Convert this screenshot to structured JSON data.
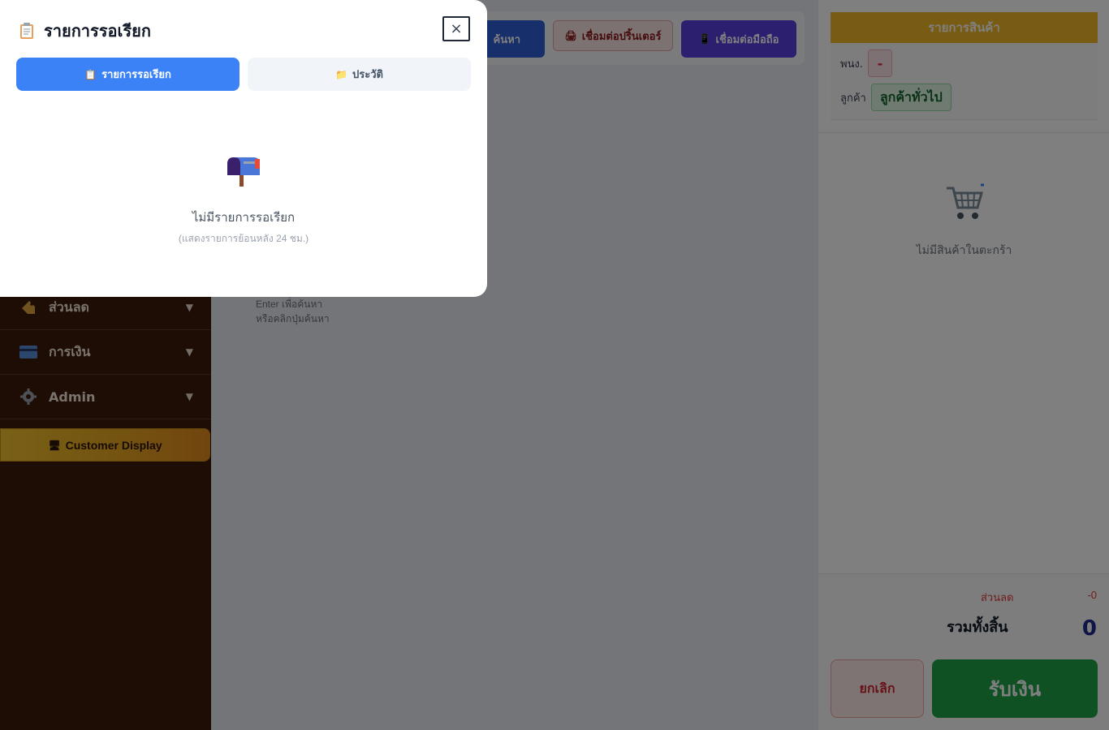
{
  "sidebar": {
    "items": [
      {
        "label": "ส่วนลด",
        "icon": "tag-icon"
      },
      {
        "label": "การเงิน",
        "icon": "credit-card-icon"
      },
      {
        "label": "Admin",
        "icon": "gear-icon"
      }
    ],
    "customer_display": "Customer Display"
  },
  "toolbar": {
    "search_label": "ค้นหา",
    "printer_label": "เชื่อมต่อปริ้นเตอร์",
    "mobile_label": "เชื่อมต่อมือถือ"
  },
  "main": {
    "hint_line1": "Enter เพื่อค้นหา",
    "hint_line2": "หรือคลิกปุ่มค้นหา"
  },
  "cart": {
    "header": "รายการสินค้า",
    "employee_label": "พนง.",
    "employee_value": "-",
    "customer_label": "ลูกค้า",
    "customer_value": "ลูกค้าทั่วไป",
    "empty_text": "ไม่มีสินค้าในตะกร้า",
    "discount_label": "ส่วนลด",
    "discount_value": "-0",
    "total_label": "รวมทั้งสิ้น",
    "total_value": "0",
    "cancel_label": "ยกเลิก",
    "pay_label": "รับเงิน"
  },
  "modal": {
    "title": "รายการรอเรียก",
    "close_symbol": "×",
    "tabs": [
      {
        "label": "รายการรอเรียก",
        "active": true
      },
      {
        "label": "ประวัติ",
        "active": false
      }
    ],
    "empty_title": "ไม่มีรายการรอเรียก",
    "empty_subtitle": "(แสดงรายการย้อนหลัง 24 ชม.)"
  },
  "colors": {
    "sidebar_bg": "#3b1a0a",
    "accent_blue": "#3b82f6",
    "pay_green": "#1fa347",
    "cart_header": "#f2b826"
  }
}
